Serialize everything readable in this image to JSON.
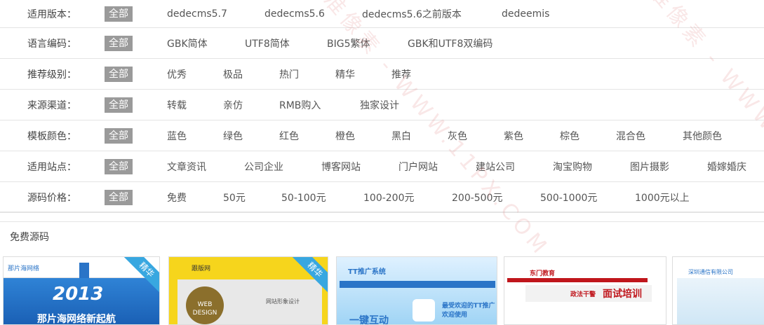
{
  "filters": [
    {
      "label": "适用版本：",
      "all": "全部",
      "options": [
        "dedecms5.7",
        "dedecms5.6",
        "dedecms5.6之前版本",
        "dedeemis"
      ]
    },
    {
      "label": "语言编码：",
      "all": "全部",
      "options": [
        "GBK简体",
        "UTF8简体",
        "BIG5繁体",
        "GBK和UTF8双编码"
      ]
    },
    {
      "label": "推荐级别：",
      "all": "全部",
      "options": [
        "优秀",
        "极品",
        "热门",
        "精华",
        "推荐"
      ]
    },
    {
      "label": "来源渠道：",
      "all": "全部",
      "options": [
        "转载",
        "亲仿",
        "RMB购入",
        "独家设计"
      ]
    },
    {
      "label": "模板颜色：",
      "all": "全部",
      "options": [
        "蓝色",
        "绿色",
        "红色",
        "橙色",
        "黑白",
        "灰色",
        "紫色",
        "棕色",
        "混合色",
        "其他颜色"
      ]
    },
    {
      "label": "适用站点：",
      "all": "全部",
      "options": [
        "文章资讯",
        "公司企业",
        "博客网站",
        "门户网站",
        "建站公司",
        "淘宝购物",
        "图片摄影",
        "婚嫁婚庆"
      ]
    },
    {
      "label": "源码价格：",
      "all": "全部",
      "options": [
        "免费",
        "50元",
        "50-100元",
        "100-200元",
        "200-500元",
        "500-1000元",
        "1000元以上"
      ]
    }
  ],
  "section": {
    "title": "免费源码"
  },
  "cards": [
    {
      "ribbon": "精华",
      "brand": "那片海网络",
      "headline": "2013",
      "subline": "那片海网络新起航"
    },
    {
      "ribbon": "精华",
      "brand": "跟版网",
      "headline": "WEB DESIGN",
      "subline": "网站形象设计"
    },
    {
      "ribbon": "",
      "brand": "TT推广系统",
      "headline": "一键互动",
      "subline": "最受欢迎的TT推广 欢迎使用"
    },
    {
      "ribbon": "",
      "brand": "东门教育",
      "headline": "面试培训",
      "subline": "政法干警"
    },
    {
      "ribbon": "",
      "brand": "深圳通信有限公司",
      "headline": "",
      "subline": ""
    }
  ],
  "watermark": "精准像素 - WWW.11PX.COM"
}
